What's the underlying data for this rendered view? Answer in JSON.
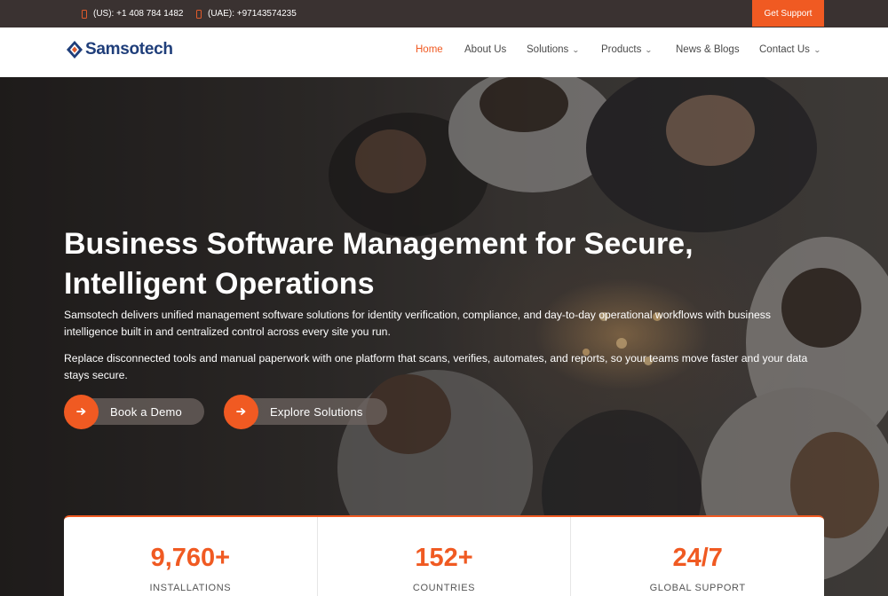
{
  "topbar": {
    "us_phone": "(US): +1 408 784 1482",
    "uae_phone": "(UAE): +97143574235",
    "support_label": "Get Support"
  },
  "brand": {
    "name": "Samsotech"
  },
  "nav": {
    "home": "Home",
    "about": "About Us",
    "solutions": "Solutions",
    "products": "Products",
    "news": "News & Blogs",
    "contact": "Contact Us"
  },
  "hero": {
    "title": "Business Software Management for Secure, Intelligent Operations",
    "paragraph1": "Samsotech delivers unified management software solutions for identity verification, compliance, and day-to-day operational workflows with business intelligence built in and centralized control across every site you run.",
    "paragraph2": "Replace disconnected tools and manual paperwork with one platform that scans, verifies, automates, and reports, so your teams move faster and your data stays secure.",
    "cta_demo": "Book a Demo",
    "cta_solutions": "Explore Solutions"
  },
  "stats": [
    {
      "value": "9,760+",
      "label": "INSTALLATIONS"
    },
    {
      "value": "152+",
      "label": "COUNTRIES"
    },
    {
      "value": "24/7",
      "label": "GLOBAL SUPPORT"
    }
  ],
  "colors": {
    "accent": "#f05a22",
    "brand": "#1f3e7a",
    "topbar": "#3a3231"
  },
  "icons": [
    "phone-icon",
    "logo-mark-icon",
    "chevron-down-icon",
    "arrow-right-icon"
  ]
}
